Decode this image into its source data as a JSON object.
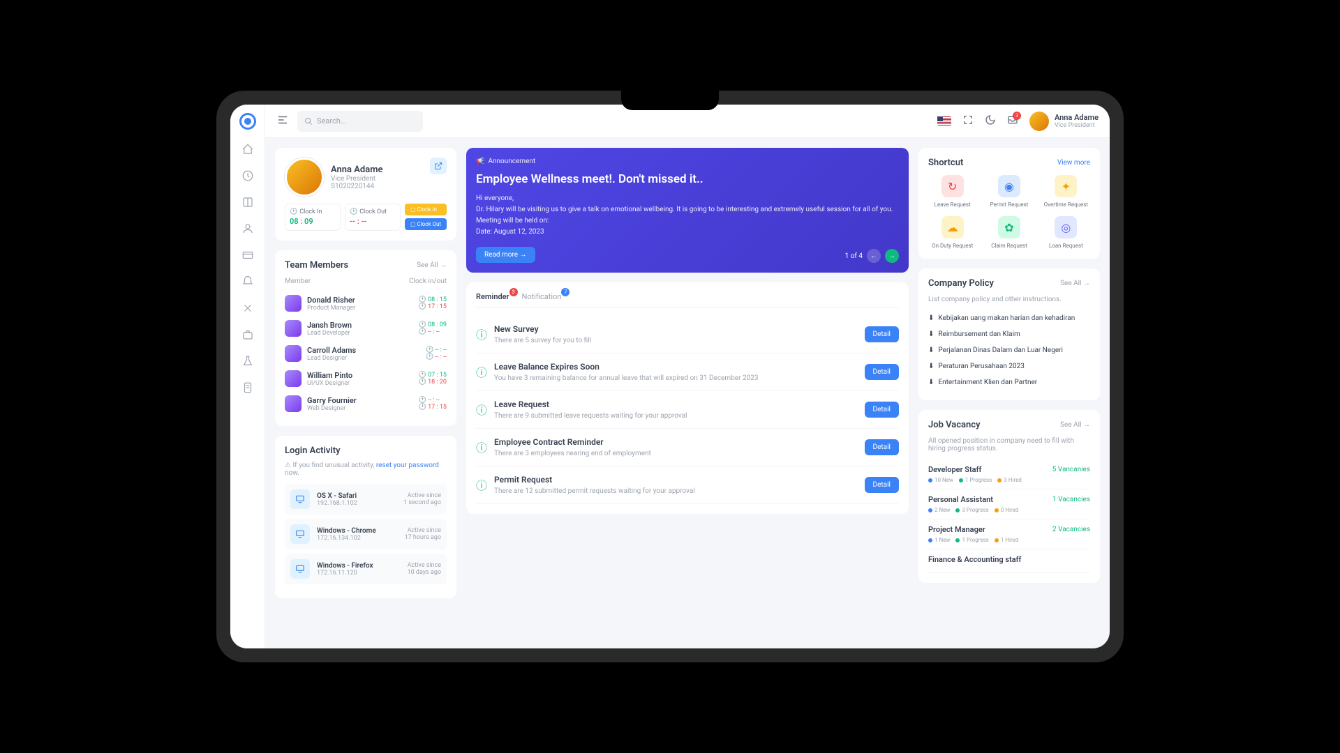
{
  "topbar": {
    "search_placeholder": "Search...",
    "notif_count": "3",
    "user_name": "Anna Adame",
    "user_role": "Vice President"
  },
  "profile": {
    "name": "Anna Adame",
    "role": "Vice President",
    "id": "S1020220144",
    "clock_in_label": "Clock In",
    "clock_out_label": "Clock Out",
    "clock_in_time": "08 : 09",
    "clock_out_time": "-- : --",
    "btn_in": "Clock In",
    "btn_out": "Clock Out"
  },
  "team": {
    "title": "Team Members",
    "see_all": "See All →",
    "hdr_member": "Member",
    "hdr_clock": "Clock in/out",
    "members": [
      {
        "name": "Donald Risher",
        "role": "Product Manager",
        "in": "08 : 15",
        "out": "17 : 15"
      },
      {
        "name": "Jansh Brown",
        "role": "Lead Developer",
        "in": "08 : 09",
        "out": "-- : --"
      },
      {
        "name": "Carroll Adams",
        "role": "Lead Designer",
        "in": "-- : --",
        "out": "-- : --"
      },
      {
        "name": "William Pinto",
        "role": "UI/UX Designer",
        "in": "07 : 15",
        "out": "18 : 20"
      },
      {
        "name": "Garry Fournier",
        "role": "Web Designer",
        "in": "-- : --",
        "out": "17 : 15"
      }
    ]
  },
  "login": {
    "title": "Login Activity",
    "warn_prefix": "If you find unusual activity, ",
    "warn_link": "reset your password",
    "warn_suffix": " now.",
    "items": [
      {
        "dev": "OS X - Safari",
        "ip": "192.168.1.102",
        "since": "Active since",
        "ago": "1 second ago"
      },
      {
        "dev": "Windows - Chrome",
        "ip": "172.16.134.102",
        "since": "Active since",
        "ago": "17 hours ago"
      },
      {
        "dev": "Windows - Firefox",
        "ip": "172.16.11.120",
        "since": "Active since",
        "ago": "10 days ago"
      }
    ]
  },
  "announce": {
    "tag": "Announcement",
    "title": "Employee Wellness meet!. Don't missed it..",
    "greeting": "Hi everyone,",
    "body": "Dr. Hilary will be visiting us to give a talk on emotional wellbeing. It is going to be interesting and extremely useful session for all of you. Meeting will be held on:",
    "date": "Date: August 12, 2023",
    "read_more": "Read more →",
    "pager": "1 of 4"
  },
  "tabs": {
    "reminder": "Reminder",
    "reminder_count": "3",
    "notification": "Notification",
    "notification_count": "7"
  },
  "reminders": [
    {
      "title": "New Survey",
      "desc": "There are 5 survey for you to fill",
      "btn": "Detail"
    },
    {
      "title": "Leave Balance Expires Soon",
      "desc": "You have 3 remaining balance for annual leave that will expired on 31 December 2023",
      "btn": "Detail"
    },
    {
      "title": "Leave Request",
      "desc": "There are 9 submitted leave requests waiting for your approval",
      "btn": "Detail"
    },
    {
      "title": "Employee Contract Reminder",
      "desc": "There are 3 employees nearing end of employment",
      "btn": "Detail"
    },
    {
      "title": "Permit Request",
      "desc": "There are 12 submitted permit requests waiting for your approval",
      "btn": "Detail"
    }
  ],
  "shortcut": {
    "title": "Shortcut",
    "view_more": "View more",
    "items": [
      {
        "label": "Leave Request",
        "cls": "sc-leave",
        "ic": "↻"
      },
      {
        "label": "Permit Request",
        "cls": "sc-permit",
        "ic": "◉"
      },
      {
        "label": "Overtime Request",
        "cls": "sc-overtime",
        "ic": "✦"
      },
      {
        "label": "On Duty Request",
        "cls": "sc-duty",
        "ic": "☁"
      },
      {
        "label": "Claim Request",
        "cls": "sc-claim",
        "ic": "✿"
      },
      {
        "label": "Loan Request",
        "cls": "sc-loan",
        "ic": "◎"
      }
    ]
  },
  "policy": {
    "title": "Company Policy",
    "see_all": "See All →",
    "desc": "List company policy and other instructions.",
    "items": [
      "Kebijakan uang makan harian dan kehadiran",
      "Reimbursement dan Klaim",
      "Perjalanan Dinas Dalam dan Luar Negeri",
      "Peraturan Perusahaan 2023",
      "Entertainment Klien dan Partner"
    ]
  },
  "vacancy": {
    "title": "Job Vacancy",
    "see_all": "See All →",
    "desc": "All opened position in company need to fill with hiring progress status.",
    "items": [
      {
        "title": "Developer Staff",
        "count": "5 Vancanies",
        "new": "10 New",
        "prog": "1 Progress",
        "hired": "3 Hired"
      },
      {
        "title": "Personal Assistant",
        "count": "1 Vacancies",
        "new": "2 New",
        "prog": "3 Progress",
        "hired": "0 Hired"
      },
      {
        "title": "Project Manager",
        "count": "2 Vacancies",
        "new": "1 New",
        "prog": "1 Progress",
        "hired": "1 Hired"
      },
      {
        "title": "Finance & Accounting staff",
        "count": "",
        "new": "",
        "prog": "",
        "hired": ""
      }
    ]
  }
}
